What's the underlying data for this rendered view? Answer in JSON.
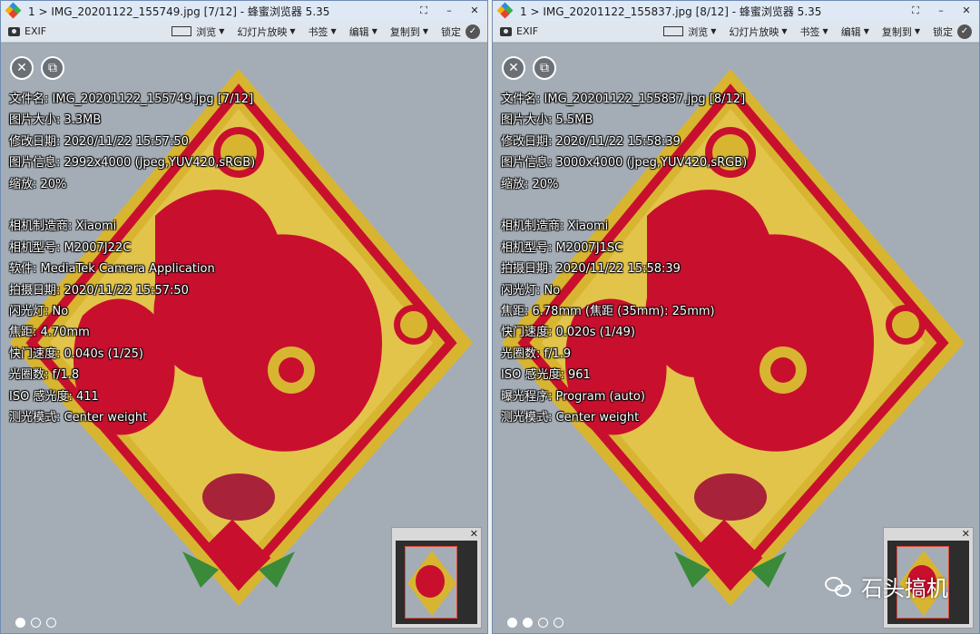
{
  "windows": [
    {
      "title": "1 > IMG_20201122_155749.jpg [7/12] - 蜂蜜浏览器 5.35",
      "toolbar": {
        "exif": "EXIF",
        "browse": "浏览",
        "slideshow": "幻灯片放映",
        "bookmark": "书签",
        "edit": "编辑",
        "copy_to": "复制到",
        "lock": "锁定"
      },
      "exif_lines": [
        "文件名: IMG_20201122_155749.jpg [7/12]",
        "图片大小: 3.3MB",
        "修改日期: 2020/11/22 15:57:50",
        "图片信息: 2992x4000 (Jpeg,YUV420,sRGB)",
        "缩放: 20%",
        "",
        "相机制造商: Xiaomi",
        "相机型号: M2007J22C",
        "软件: MediaTek Camera Application",
        "拍摄日期: 2020/11/22 15:57:50",
        "闪光灯: No",
        "焦距: 4.70mm",
        "快门速度: 0.040s (1/25)",
        "光圈数: f/1.8",
        "ISO 感光度: 411",
        "测光模式: Center weight"
      ],
      "dots": [
        true,
        false,
        false
      ]
    },
    {
      "title": "1 > IMG_20201122_155837.jpg [8/12] - 蜂蜜浏览器 5.35",
      "toolbar": {
        "exif": "EXIF",
        "browse": "浏览",
        "slideshow": "幻灯片放映",
        "bookmark": "书签",
        "edit": "编辑",
        "copy_to": "复制到",
        "lock": "锁定"
      },
      "exif_lines": [
        "文件名: IMG_20201122_155837.jpg [8/12]",
        "图片大小: 5.5MB",
        "修改日期: 2020/11/22 15:58:39",
        "图片信息: 3000x4000 (Jpeg,YUV420,sRGB)",
        "缩放: 20%",
        "",
        "相机制造商: Xiaomi",
        "相机型号: M2007J1SC",
        "拍摄日期: 2020/11/22 15:58:39",
        "闪光灯: No",
        "焦距: 6.78mm (焦距 (35mm): 25mm)",
        "快门速度: 0.020s (1/49)",
        "光圈数: f/1.9",
        "ISO 感光度: 961",
        "曝光程序: Program (auto)",
        "测光模式: Center weight"
      ],
      "dots": [
        true,
        true,
        false,
        false
      ]
    }
  ],
  "icons": {
    "close": "close-icon",
    "copy": "copy-icon",
    "camera": "camera-icon",
    "lock_check": "check-icon"
  },
  "watermark": "石头搞机",
  "colors": {
    "titlebar": "#dfe9f5",
    "toolbar": "#dfe6ee",
    "background": "#a4adb6",
    "accent_red": "#c8102e",
    "accent_gold": "#d8b531"
  }
}
